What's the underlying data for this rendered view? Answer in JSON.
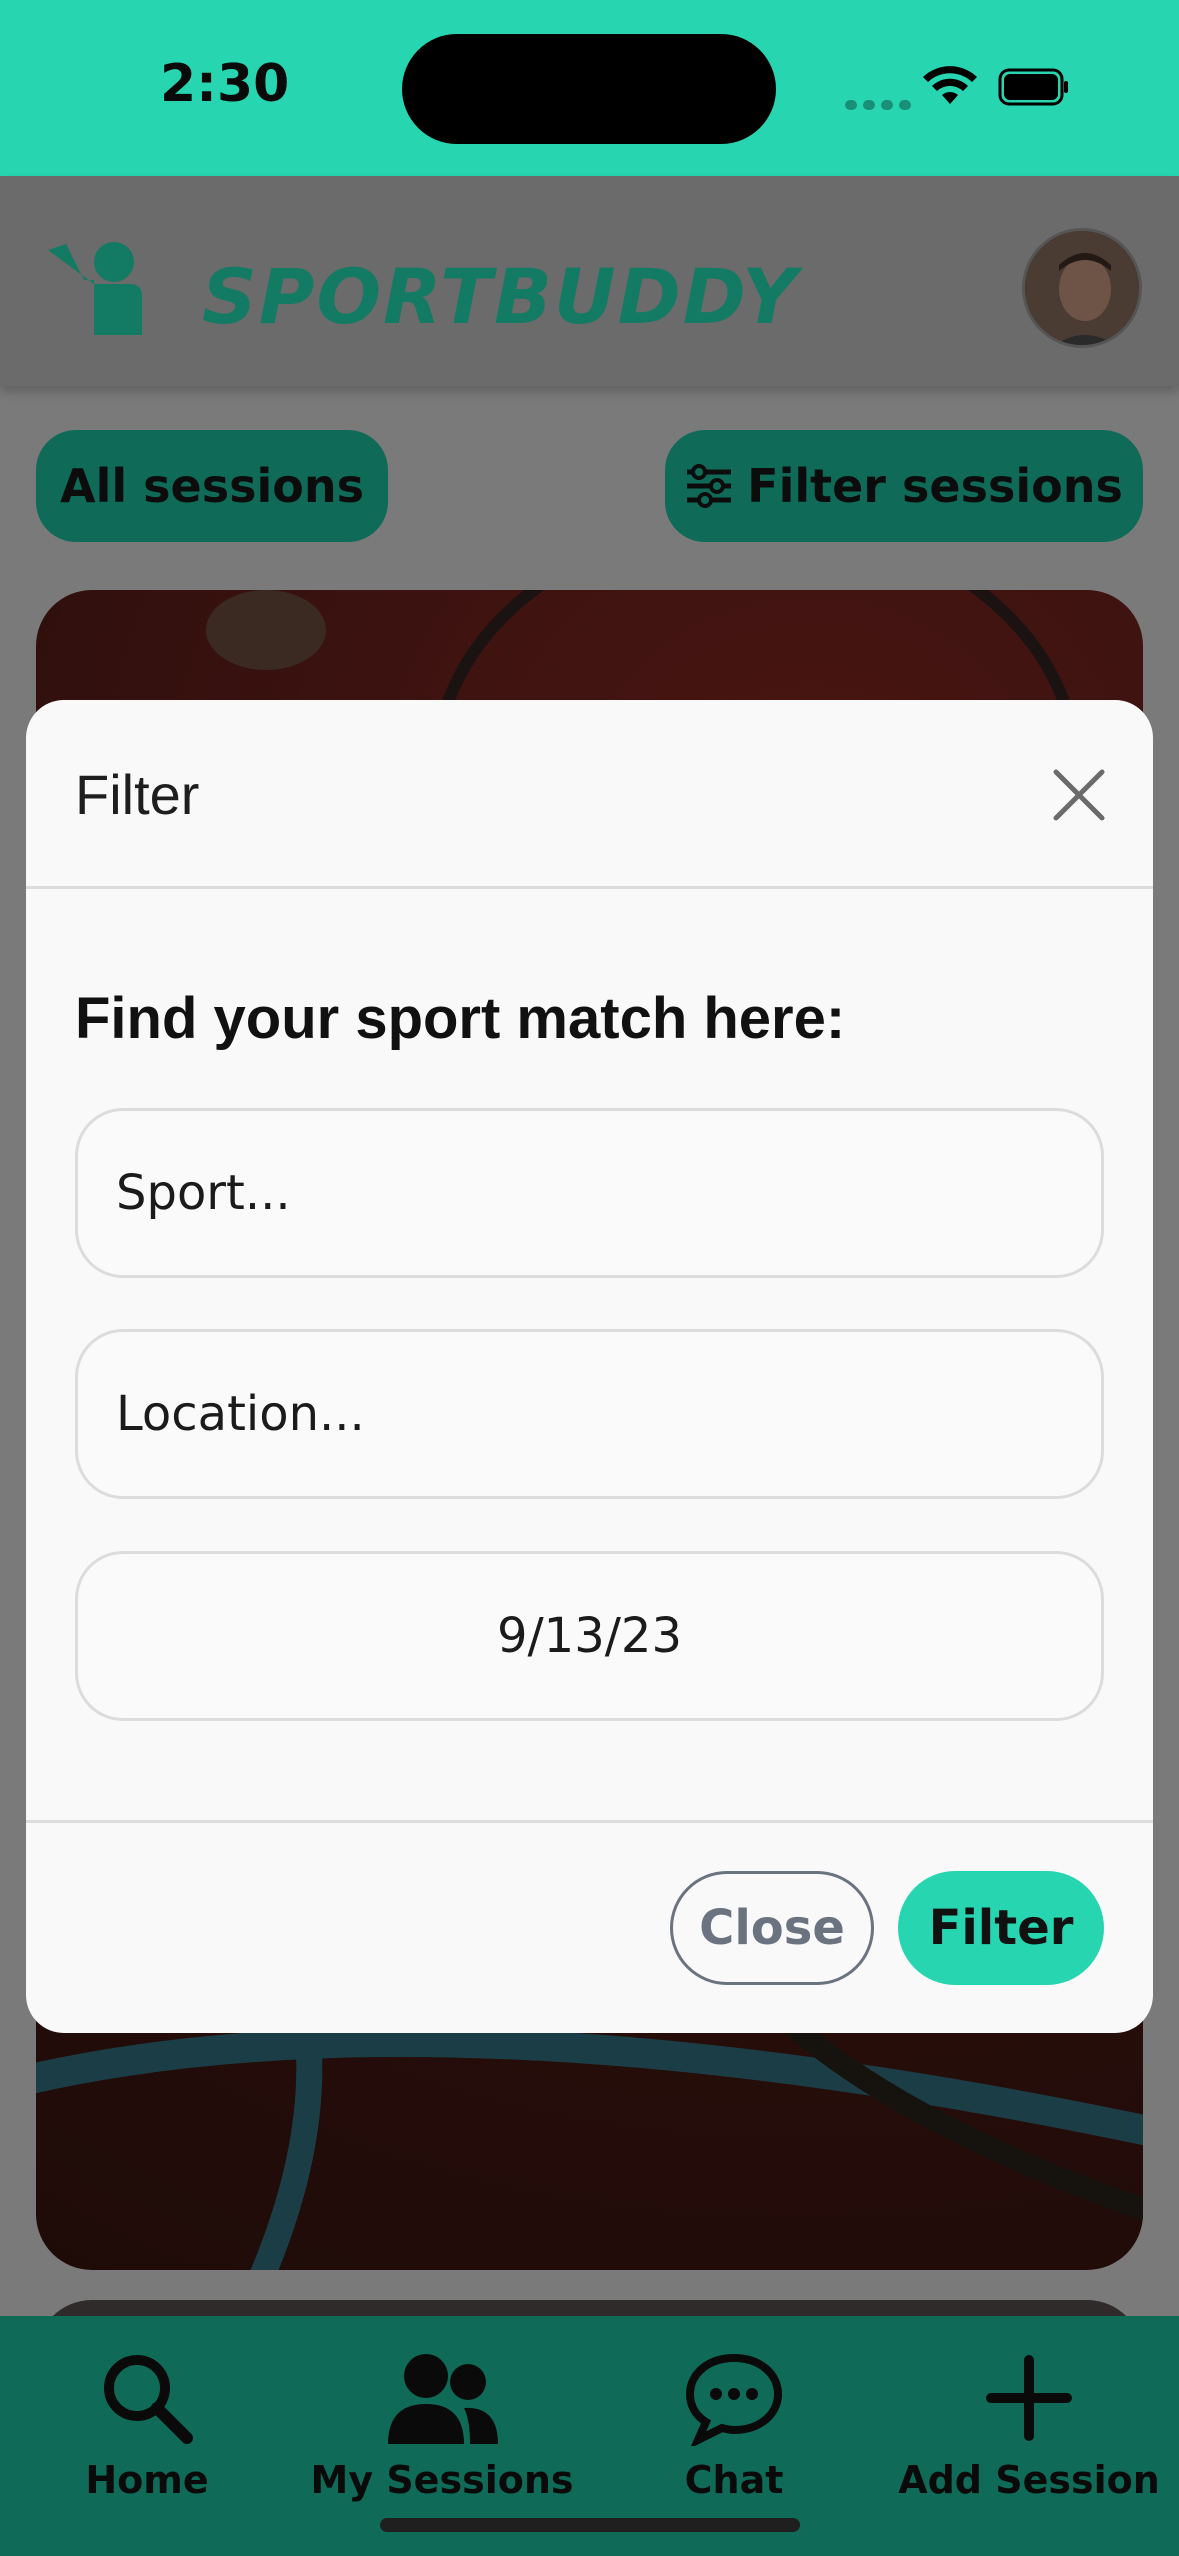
{
  "status_bar": {
    "time": "2:30"
  },
  "app": {
    "name": "SPORTBUDDY",
    "buttons": {
      "all_sessions": "All sessions",
      "filter_sessions": "Filter sessions"
    }
  },
  "modal": {
    "title": "Filter",
    "heading": "Find your sport match here:",
    "sport_placeholder": "Sport...",
    "location_placeholder": "Location...",
    "date_value": "9/13/23",
    "close_label": "Close",
    "filter_label": "Filter"
  },
  "bottom_nav": {
    "items": [
      {
        "label": "Home",
        "icon": "search-icon"
      },
      {
        "label": "My Sessions",
        "icon": "users-icon"
      },
      {
        "label": "Chat",
        "icon": "chat-icon"
      },
      {
        "label": "Add Session",
        "icon": "plus-icon"
      }
    ]
  },
  "colors": {
    "accent": "#27d6b0",
    "dark_accent": "#0f6b58",
    "secondary": "#6b7380"
  }
}
